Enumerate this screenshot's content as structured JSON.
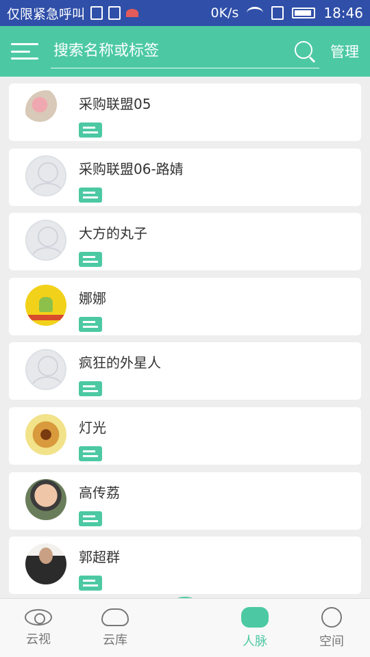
{
  "status": {
    "carrier_text": "仅限紧急呼叫",
    "net_speed": "0K/s",
    "time": "18:46"
  },
  "header": {
    "search_placeholder": "搜索名称或标签",
    "manage_label": "管理"
  },
  "contacts": [
    {
      "name": "采购联盟05",
      "avatar": "flowers"
    },
    {
      "name": "采购联盟06-路婧",
      "avatar": "default"
    },
    {
      "name": "大方的丸子",
      "avatar": "default"
    },
    {
      "name": "娜娜",
      "avatar": "android"
    },
    {
      "name": "疯狂的外星人",
      "avatar": "default"
    },
    {
      "name": "灯光",
      "avatar": "cookie"
    },
    {
      "name": "高传荔",
      "avatar": "baby"
    },
    {
      "name": "郭超群",
      "avatar": "man"
    }
  ],
  "nav": [
    {
      "label": "云视",
      "icon": "eye-icon",
      "active": false
    },
    {
      "label": "云库",
      "icon": "cloud-icon",
      "active": false
    },
    {
      "label": "人脉",
      "icon": "people-icon",
      "active": true
    },
    {
      "label": "空间",
      "icon": "planet-icon",
      "active": false
    }
  ],
  "fab_label": "+",
  "colors": {
    "accent": "#4cc9a3",
    "status_bar": "#2f4fa8"
  }
}
